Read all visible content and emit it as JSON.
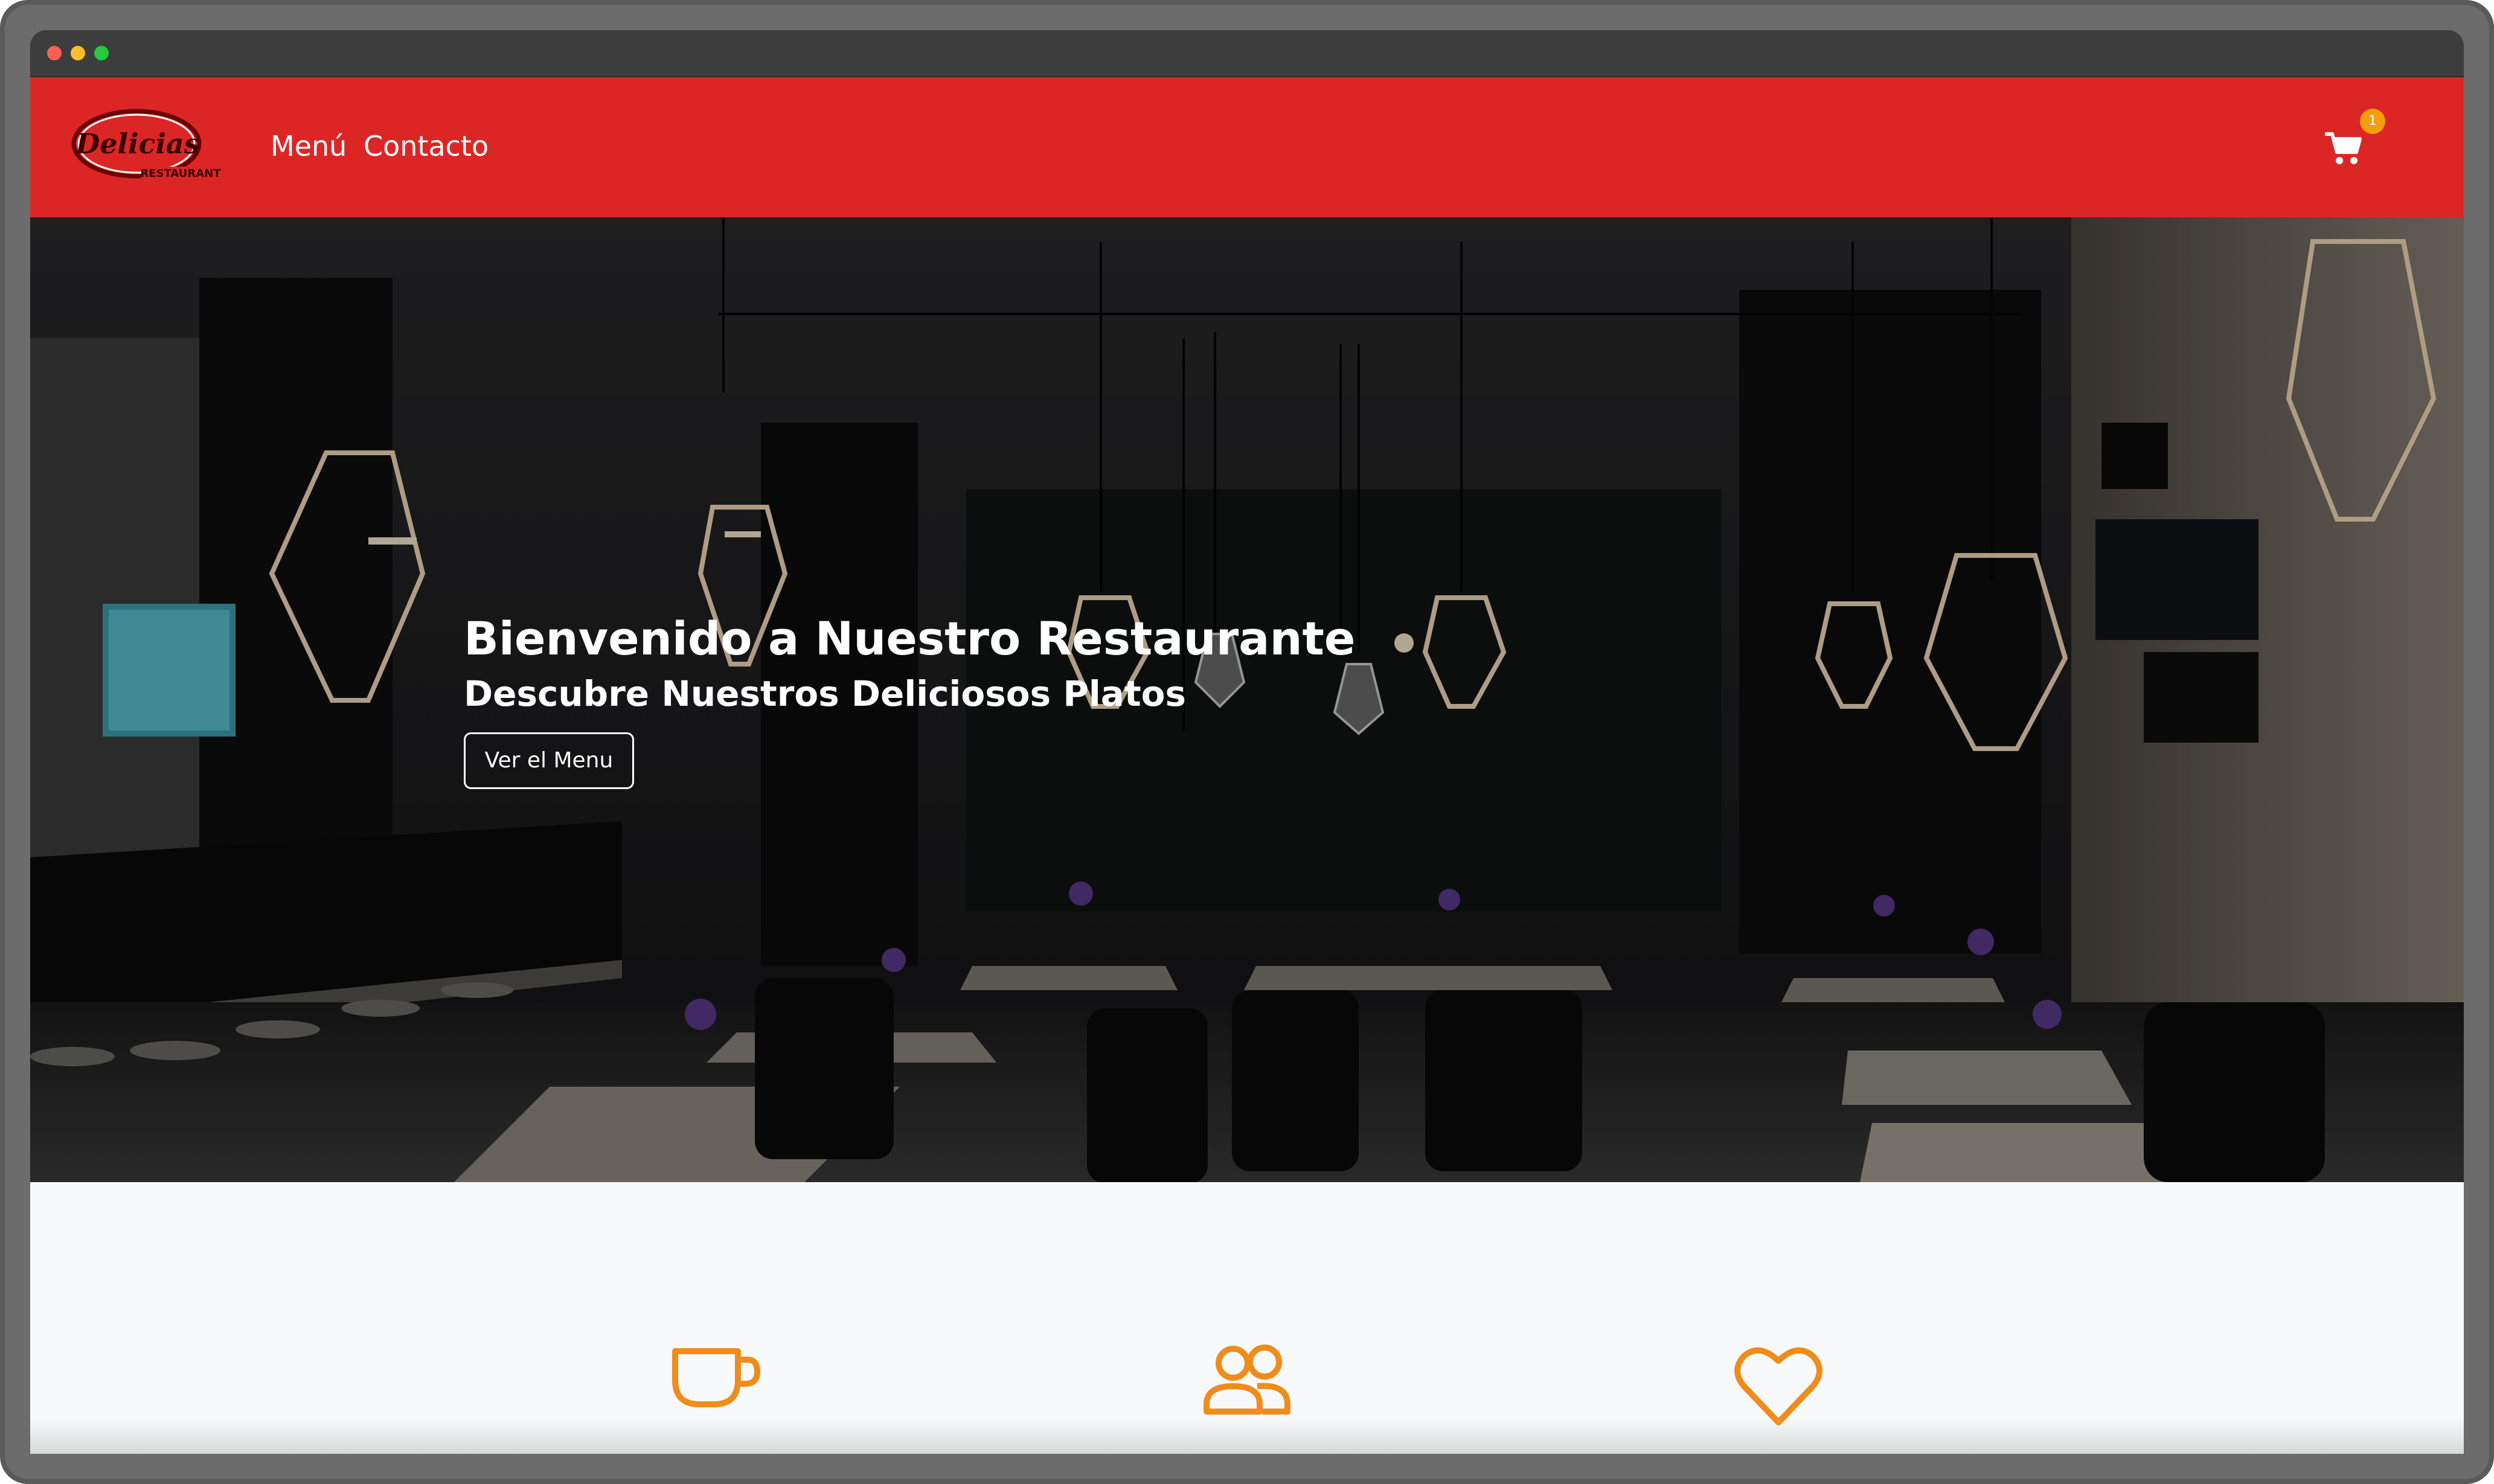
{
  "browser": {
    "traffic_lights": [
      "close",
      "minimize",
      "zoom"
    ]
  },
  "navbar": {
    "logo_text": "Delicias",
    "logo_subtext": "RESTAURANT",
    "links": [
      {
        "label": "Menú"
      },
      {
        "label": "Contacto"
      }
    ],
    "cart_icon": "cart-icon",
    "cart_count": "1",
    "background_color": "#dc2626"
  },
  "hero": {
    "title": "Bienvenido a Nuestro Restaurante",
    "subtitle": "Descubre Nuestros Deliciosos Platos",
    "button_label": "Ver el Menu"
  },
  "features": {
    "icons": [
      "coffee-cup-icon",
      "users-icon",
      "heart-icon"
    ],
    "accent_color": "#f08c1a"
  }
}
